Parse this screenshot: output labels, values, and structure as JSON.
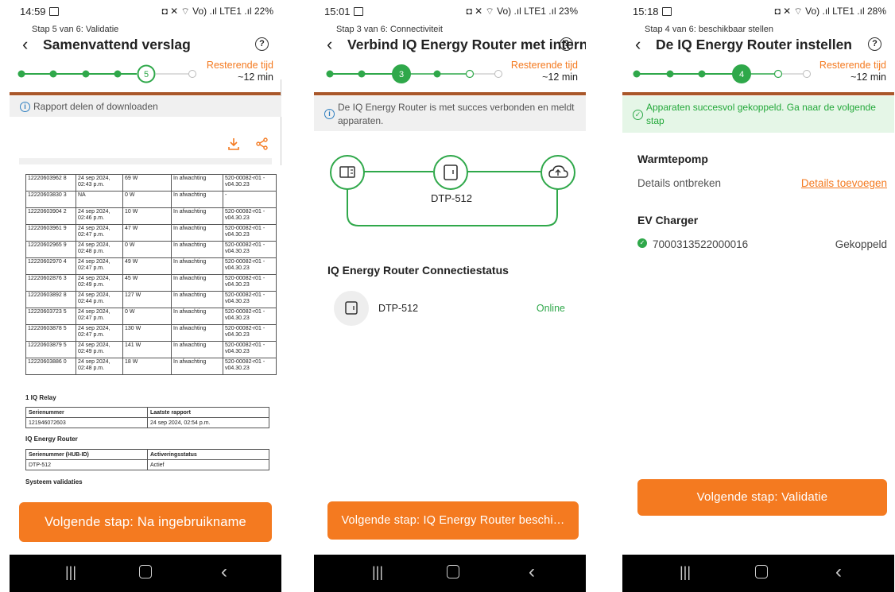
{
  "colors": {
    "accent": "#f47a20",
    "green": "#2fa84a",
    "separator": "#a9572a",
    "link": "#f47a20"
  },
  "nav_icons": [
    "recents-icon",
    "home-icon",
    "back-icon"
  ],
  "phone1": {
    "status": {
      "time": "14:59",
      "signal": "◘ ✕ ⌔ Vo) .ıl LTE1 .ıl 22%"
    },
    "step": "Stap 5 van 6: Validatie",
    "title": "Samenvattend verslag",
    "help": "?",
    "current_step": "5",
    "remaining_label": "Resterende tijd",
    "remaining_value": "~12 min",
    "banner": "Rapport delen of downloaden",
    "rows": [
      [
        "12220603962 8",
        "24 sep 2024, 02:43 p.m.",
        "69 W",
        "In afwachting",
        "520-00082-r01 -v04.30.23"
      ],
      [
        "12220603830 3",
        "NA",
        "0 W",
        "In afwachting",
        "-"
      ],
      [
        "12220603904 2",
        "24 sep 2024, 02:46 p.m.",
        "10 W",
        "In afwachting",
        "520-00082-r01 -v04.30.23"
      ],
      [
        "12220603961 9",
        "24 sep 2024, 02:47 p.m.",
        "47 W",
        "In afwachting",
        "520-00082-r01 -v04.30.23"
      ],
      [
        "12220602965 9",
        "24 sep 2024, 02:48 p.m.",
        "0 W",
        "In afwachting",
        "520-00082-r01 -v04.30.23"
      ],
      [
        "12220602970 4",
        "24 sep 2024, 02:47 p.m.",
        "49 W",
        "In afwachting",
        "520-00082-r01 -v04.30.23"
      ],
      [
        "12220602876 3",
        "24 sep 2024, 02:49 p.m.",
        "45 W",
        "In afwachting",
        "520-00082-r01 -v04.30.23"
      ],
      [
        "12220603892 8",
        "24 sep 2024, 02:44 p.m.",
        "127 W",
        "In afwachting",
        "520-00082-r01 -v04.30.23"
      ],
      [
        "12220603723 5",
        "24 sep 2024, 02:47 p.m.",
        "0 W",
        "In afwachting",
        "520-00082-r01 -v04.30.23"
      ],
      [
        "12220603878 5",
        "24 sep 2024, 02:47 p.m.",
        "130 W",
        "In afwachting",
        "520-00082-r01 -v04.30.23"
      ],
      [
        "12220603879 5",
        "24 sep 2024, 02:49 p.m.",
        "141 W",
        "In afwachting",
        "520-00082-r01 -v04.30.23"
      ],
      [
        "12220603886 0",
        "24 sep 2024, 02:48 p.m.",
        "18 W",
        "In afwachting",
        "520-00082-r01 -v04.30.23"
      ]
    ],
    "relay_heading": "1 IQ Relay",
    "relay_headers": [
      "Serienummer",
      "Laatste rapport"
    ],
    "relay_row": [
      "121946072603",
      "24 sep 2024, 02:54 p.m."
    ],
    "router_heading": "IQ Energy Router",
    "router_headers": [
      "Serienummer (HUB-ID)",
      "Activeringsstatus"
    ],
    "router_row": [
      "DTP-512",
      "Actief"
    ],
    "system_heading": "Systeem validaties",
    "cta": "Volgende stap: Na ingebruikname"
  },
  "phone2": {
    "status": {
      "time": "15:01",
      "signal": "◘ ✕ ⌔ Vo) .ıl LTE1 .ıl 23%"
    },
    "step": "Stap 3 van 6: Connectiviteit",
    "title": "Verbind IQ Energy Router met internet",
    "help": "?",
    "current_step": "3",
    "remaining_label": "Resterende tijd",
    "remaining_value": "~12 min",
    "banner": "De IQ Energy Router is met succes verbonden en meldt apparaten.",
    "hub_label": "DTP-512",
    "section_title": "IQ Energy Router Connectiestatus",
    "device_name": "DTP-512",
    "device_status": "Online",
    "cta": "Volgende stap: IQ Energy Router beschi…"
  },
  "phone3": {
    "status": {
      "time": "15:18",
      "signal": "◘ ✕ ⌔ Vo) .ıl LTE1 .ıl 28%"
    },
    "step": "Stap 4 van 6: beschikbaar stellen",
    "title": "De IQ Energy Router instellen",
    "help": "?",
    "current_step": "4",
    "remaining_label": "Resterende tijd",
    "remaining_value": "~12 min",
    "banner": "Apparaten succesvol gekoppeld. Ga naar de volgende stap",
    "heatpump_title": "Warmtepomp",
    "heatpump_details": "Details ontbreken",
    "heatpump_link": "Details toevoegen",
    "ev_title": "EV Charger",
    "ev_serial": "7000313522000016",
    "ev_status": "Gekoppeld",
    "cta": "Volgende stap: Validatie"
  }
}
